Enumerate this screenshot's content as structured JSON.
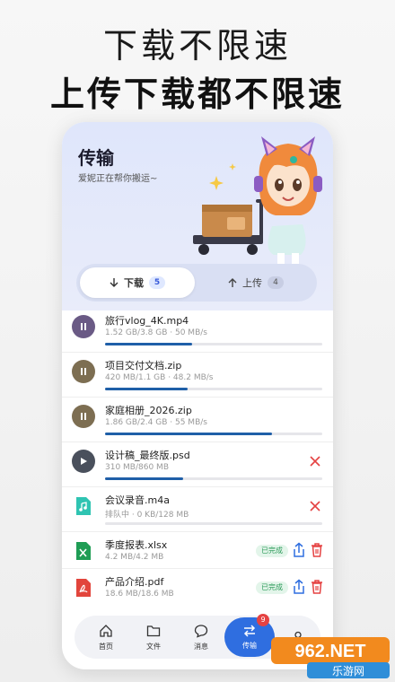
{
  "promo": {
    "line1": "下载不限速",
    "line2": "上传下载都不限速"
  },
  "header": {
    "title": "传输",
    "subtitle": "爱妮正在帮你搬运~"
  },
  "segments": {
    "download": {
      "label": "下载",
      "count": "5",
      "icon": "arrow-down-icon"
    },
    "upload": {
      "label": "上传",
      "count": "4",
      "icon": "arrow-up-icon"
    }
  },
  "transfers": [
    {
      "name": "旅行vlog_4K.mp4",
      "meta": "1.52 GB/3.8 GB · 50 MB/s",
      "progress": 0.4,
      "status": "downloading",
      "icon": "pause-icon"
    },
    {
      "name": "项目交付文档.zip",
      "meta": "420 MB/1.1 GB · 48.2 MB/s",
      "progress": 0.38,
      "status": "downloading",
      "icon": "pause-icon"
    },
    {
      "name": "家庭相册_2026.zip",
      "meta": "1.86 GB/2.4 GB · 55 MB/s",
      "progress": 0.77,
      "status": "downloading",
      "icon": "pause-icon"
    },
    {
      "name": "设计稿_最终版.psd",
      "meta": "310 MB/860 MB",
      "progress": 0.36,
      "status": "paused",
      "icon": "play-icon"
    },
    {
      "name": "会议录音.m4a",
      "meta": "排队中 · 0 KB/128 MB",
      "progress": 0,
      "status": "queued",
      "icon": "music-file-icon"
    },
    {
      "name": "季度报表.xlsx",
      "meta": "4.2 MB/4.2 MB",
      "progress": 1,
      "status": "done",
      "done_label": "已完成",
      "icon": "excel-file-icon"
    },
    {
      "name": "产品介绍.pdf",
      "meta": "18.6 MB/18.6 MB",
      "progress": 1,
      "status": "done",
      "done_label": "已完成",
      "icon": "pdf-file-icon"
    }
  ],
  "tabbar": {
    "items": [
      {
        "label": "首页",
        "icon": "home-icon"
      },
      {
        "label": "文件",
        "icon": "folder-icon"
      },
      {
        "label": "消息",
        "icon": "chat-icon"
      },
      {
        "label": "传输",
        "icon": "transfer-icon",
        "badge": "9",
        "active": true
      },
      {
        "label": "",
        "icon": "profile-icon"
      }
    ]
  },
  "watermark": {
    "brand": "962.NET",
    "text": "乐游网"
  },
  "colors": {
    "accent": "#2f6ee0",
    "progress": "#1f5fa8",
    "cancel": "#e54242",
    "done": "#2e9b5b"
  }
}
